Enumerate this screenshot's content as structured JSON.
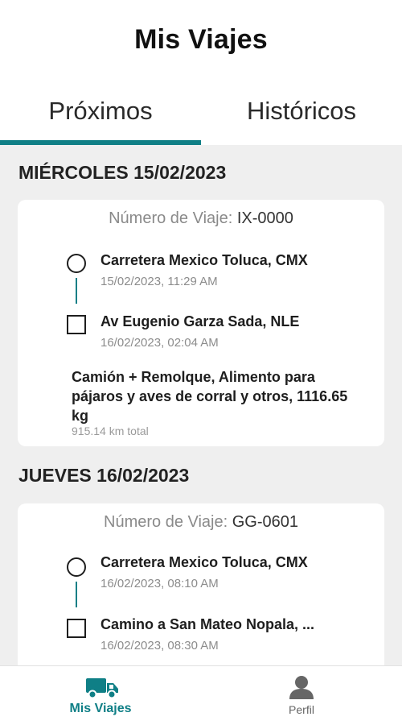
{
  "header": {
    "title": "Mis Viajes"
  },
  "tabs": [
    {
      "label": "Próximos",
      "active": true
    },
    {
      "label": "Históricos",
      "active": false
    }
  ],
  "accent_color": "#0f7f86",
  "days": [
    {
      "heading": "MIÉRCOLES 15/02/2023",
      "trip": {
        "number_label": "Número de Viaje:",
        "number": "IX-0000",
        "origin": {
          "name": "Carretera Mexico Toluca, CMX",
          "datetime": "15/02/2023, 11:29 AM",
          "icon": "circle-icon"
        },
        "destination": {
          "name": "Av Eugenio Garza Sada, NLE",
          "datetime": "16/02/2023, 02:04 AM",
          "icon": "square-icon"
        },
        "cargo": "Camión + Remolque, Alimento para pájaros y aves de corral y otros, 1116.65 kg",
        "distance": "915.14 km total"
      }
    },
    {
      "heading": "JUEVES 16/02/2023",
      "trip": {
        "number_label": "Número de Viaje:",
        "number": "GG-0601",
        "origin": {
          "name": "Carretera Mexico Toluca, CMX",
          "datetime": "16/02/2023, 08:10 AM",
          "icon": "circle-icon"
        },
        "destination": {
          "name": "Camino a San Mateo Nopala, ...",
          "datetime": "16/02/2023, 08:30 AM",
          "icon": "square-icon"
        }
      }
    }
  ],
  "bottom_nav": [
    {
      "label": "Mis Viajes",
      "icon": "truck-icon",
      "active": true
    },
    {
      "label": "Perfil",
      "icon": "user-icon",
      "active": false
    }
  ]
}
